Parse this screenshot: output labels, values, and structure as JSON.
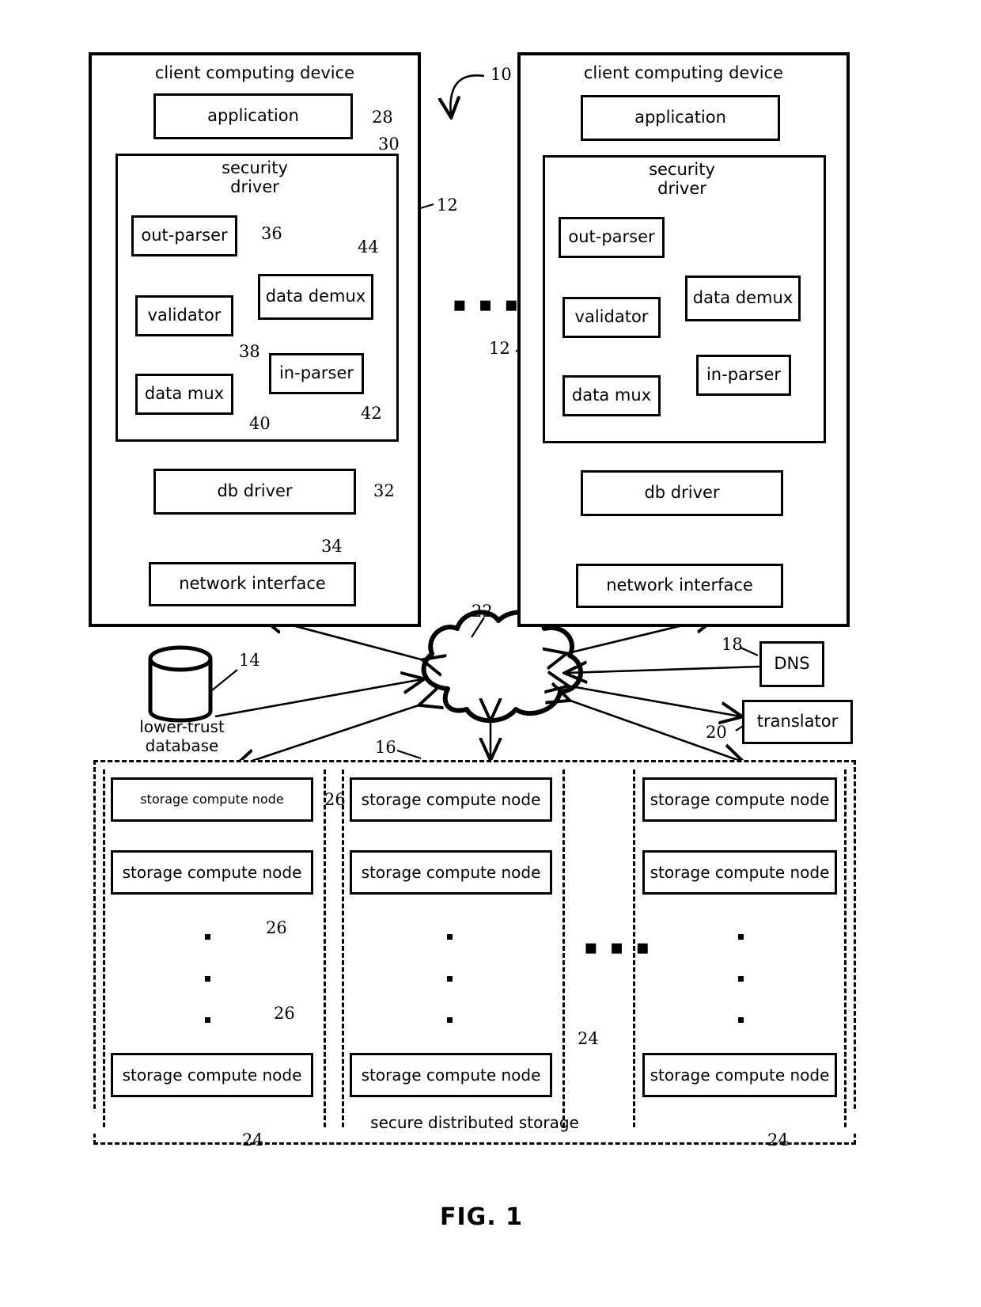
{
  "figure": {
    "caption": "FIG. 1",
    "system_ref": "10"
  },
  "clients": [
    {
      "title": "client computing device",
      "ref": "12",
      "application": {
        "label": "application",
        "ref": "28"
      },
      "security_driver": {
        "label": "security\ndriver",
        "ref": "30"
      },
      "blocks": [
        {
          "label": "out-parser",
          "ref": "36"
        },
        {
          "label": "validator",
          "ref": "38"
        },
        {
          "label": "data mux",
          "ref": "40"
        },
        {
          "label": "data demux",
          "ref": "44"
        },
        {
          "label": "in-parser",
          "ref": "42"
        }
      ],
      "db_driver": {
        "label": "db driver",
        "ref": "32"
      },
      "network_interface": {
        "label": "network interface",
        "ref": "34"
      }
    },
    {
      "title": "client computing device",
      "ref": "12",
      "application": {
        "label": "application",
        "ref": ""
      },
      "security_driver": {
        "label": "security\ndriver",
        "ref": ""
      },
      "blocks": [
        {
          "label": "out-parser",
          "ref": ""
        },
        {
          "label": "validator",
          "ref": ""
        },
        {
          "label": "data mux",
          "ref": ""
        },
        {
          "label": "data demux",
          "ref": ""
        },
        {
          "label": "in-parser",
          "ref": ""
        }
      ],
      "db_driver": {
        "label": "db driver",
        "ref": ""
      },
      "network_interface": {
        "label": "network interface",
        "ref": ""
      }
    }
  ],
  "clients_ellipsis": "▪ ▪ ▪",
  "network": {
    "cloud_ref": "22"
  },
  "lower_trust_db": {
    "label": "lower-trust\ndatabase",
    "label_line1": "lower-trust",
    "label_line2": "database",
    "ref": "14"
  },
  "dns": {
    "label": "DNS",
    "ref": "18"
  },
  "translator": {
    "label": "translator",
    "ref": "20"
  },
  "secure_storage": {
    "label": "secure distributed storage",
    "ref": "16",
    "column_ref": "24",
    "node_ref": "26",
    "node_label": "storage compute node",
    "columns": [
      {
        "ref": "24",
        "nodes": [
          "storage compute node",
          "storage compute node",
          "storage compute node"
        ]
      },
      {
        "ref": "24",
        "nodes": [
          "storage compute node",
          "storage compute node",
          "storage compute node"
        ]
      },
      {
        "ref": "24",
        "nodes": [
          "storage compute node",
          "storage compute node",
          "storage compute node"
        ]
      }
    ],
    "columns_ellipsis": "▪ ▪ ▪"
  },
  "colors": {
    "stroke": "#000000",
    "background": "#ffffff"
  }
}
